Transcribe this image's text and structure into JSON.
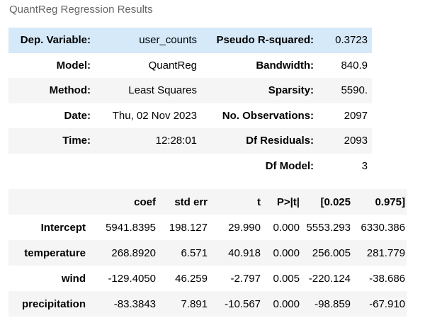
{
  "caption": "QuantReg Regression Results",
  "summary": [
    [
      "Dep. Variable:",
      "user_counts",
      "Pseudo R-squared:",
      "0.3723"
    ],
    [
      "Model:",
      "QuantReg",
      "Bandwidth:",
      "840.9"
    ],
    [
      "Method:",
      "Least Squares",
      "Sparsity:",
      "5590."
    ],
    [
      "Date:",
      "Thu, 02 Nov 2023",
      "No. Observations:",
      "2097"
    ],
    [
      "Time:",
      "12:28:01",
      "Df Residuals:",
      "2093"
    ],
    [
      "",
      "",
      "Df Model:",
      "3"
    ]
  ],
  "coef_table": {
    "headers": [
      "",
      "coef",
      "std err",
      "t",
      "P>|t|",
      "[0.025",
      "0.975]"
    ],
    "rows": [
      [
        "Intercept",
        "5941.8395",
        "198.127",
        "29.990",
        "0.000",
        "5553.293",
        "6330.386"
      ],
      [
        "temperature",
        "268.8920",
        "6.571",
        "40.918",
        "0.000",
        "256.005",
        "281.779"
      ],
      [
        "wind",
        "-129.4050",
        "46.259",
        "-2.797",
        "0.005",
        "-220.124",
        "-38.686"
      ],
      [
        "precipitation",
        "-83.3843",
        "7.891",
        "-10.567",
        "0.000",
        "-98.859",
        "-67.910"
      ]
    ]
  },
  "colors": {
    "row_stripe": "#f5f5f5",
    "row_highlight": "#d5e9f9",
    "caption": "#666666"
  }
}
